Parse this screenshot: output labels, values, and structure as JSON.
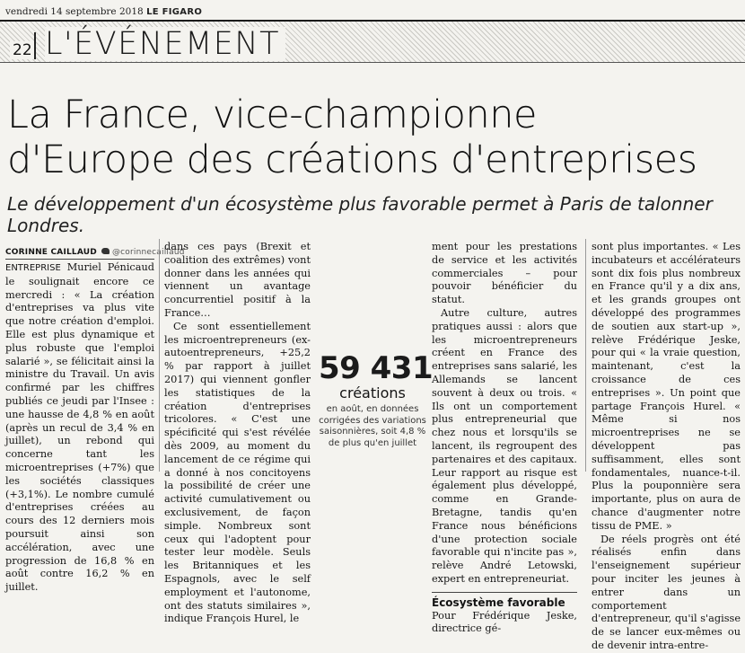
{
  "masthead": {
    "date": "vendredi 14 septembre 2018",
    "paper": "LE FIGARO"
  },
  "section": {
    "page_number": "22",
    "title": "L'ÉVÉNEMENT"
  },
  "headline": {
    "line1": "La France, vice-championne",
    "line2": "d'Europe des créations d'entreprises"
  },
  "subheadline": "Le développement d'un écosystème plus favorable permet à Paris de talonner Londres.",
  "byline": {
    "author": "CORINNE CAILLAUD",
    "handle": "@corinnecaillaud"
  },
  "stat": {
    "number": "59 431",
    "label": "créations",
    "description": "en août, en données corrigées des variations saisonnières, soit 4,8 % de plus qu'en juillet"
  },
  "column1": {
    "lead": "ENTREPRISE",
    "text": "Muriel Pénicaud le soulignait encore ce mercredi : « La création d'entreprises va plus vite que notre création d'emploi. Elle est plus dynamique et plus robuste que l'emploi salarié », se félicitait ainsi la ministre du Travail. Un avis confirmé par les chiffres publiés ce jeudi par l'Insee : une hausse de 4,8 % en août (après un recul de 3,4 % en juillet), un rebond qui concerne tant les microentreprises (+7%) que les sociétés classiques (+3,1%). Le nombre cumulé d'entreprises créées au cours des 12 derniers mois poursuit ainsi son accélération, avec une progression de 16,8 % en août contre 16,2 % en juillet."
  },
  "column2": {
    "p1": "dans ces pays (Brexit et coalition des extrêmes) vont donner dans les années qui viennent un avantage concurrentiel positif à la France…",
    "p2": "Ce sont essentiellement les microentrepreneurs (ex-autoentrepreneurs, +25,2 % par rapport à juillet 2017) qui viennent gonfler les statistiques de la création d'entreprises tricolores. « C'est une spécificité qui s'est révélée dès 2009, au moment du lancement de ce régime qui a donné à nos concitoyens la possibilité de créer une activité cumulativement ou exclusivement, de façon simple. Nombreux sont ceux qui l'adoptent pour tester leur modèle. Seuls les Britanniques et les Espagnols, avec le self employment et l'autonome, ont des statuts similaires », indique François Hurel, le"
  },
  "column3": {
    "p1": "ment pour les prestations de service et les activités commerciales – pour pouvoir bénéficier du statut.",
    "p2": "Autre culture, autres pratiques aussi : alors que les microentrepreneurs créent en France des entreprises sans salarié, les Allemands se lancent souvent à deux ou trois. « Ils ont un comportement plus entrepreneurial que chez nous et lorsqu'ils se lancent, ils regroupent des partenaires et des capitaux. Leur rapport au risque est également plus développé, comme en Grande-Bretagne, tandis qu'en France nous bénéficions d'une protection sociale favorable qui n'incite pas », relève André Letowski, expert en entrepreneuriat.",
    "subsection": "Écosystème favorable",
    "p3": "Pour Frédérique Jeske, directrice gé-"
  },
  "column4": {
    "p1": "sont plus importantes. « Les incubateurs et accélérateurs sont dix fois plus nombreux en France qu'il y a dix ans, et les grands groupes ont développé des programmes de soutien aux start-up », relève Frédérique Jeske, pour qui « la vraie question, maintenant, c'est la croissance de ces entreprises ». Un point que partage François Hurel. « Même si nos microentreprises ne se développent pas suffisamment, elles sont fondamentales, nuance-t-il. Plus la pouponnière sera importante, plus on aura de chance d'augmenter notre tissu de PME. »",
    "p2": "De réels progrès ont été réalisés enfin dans l'enseignement supérieur pour inciter les jeunes à entrer dans un comportement d'entrepreneur, qu'il s'agisse de se lancer eux-mêmes ou de devenir intra-entre-"
  }
}
